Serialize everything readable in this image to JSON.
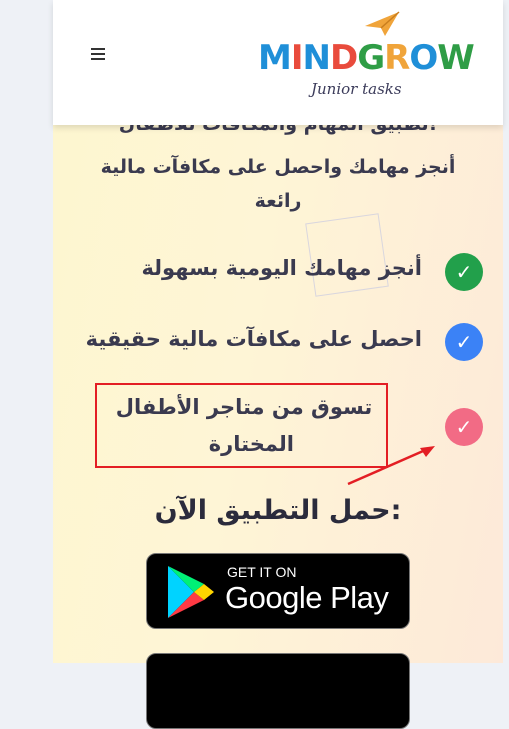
{
  "header": {
    "brand_name": "MINDGROW",
    "brand_tagline": "Junior tasks",
    "menu_icon": "hamburger-menu-icon"
  },
  "intro": {
    "title": "تطبيق المهام والمكافآت للأطفال!",
    "line1": "أنجز مهامك واحصل على مكافآت مالية",
    "line2": "رائعة"
  },
  "features": [
    {
      "text": "أنجز مهامك اليومية بسهولة",
      "icon": "check-icon",
      "color": "#22a04b"
    },
    {
      "text": "احصل على مكافآت مالية حقيقية",
      "icon": "check-icon",
      "color": "#3b82f6"
    },
    {
      "text_line1": "تسوق من متاجر الأطفال",
      "text_line2": "المختارة",
      "icon": "check-icon",
      "color": "#f26b85"
    }
  ],
  "check_glyph": "✓",
  "cta": {
    "title": "حمل التطبيق الآن:",
    "google_play_small": "GET IT ON",
    "google_play_large": "Google Play"
  },
  "annotation": {
    "box_color": "#e31e24"
  }
}
